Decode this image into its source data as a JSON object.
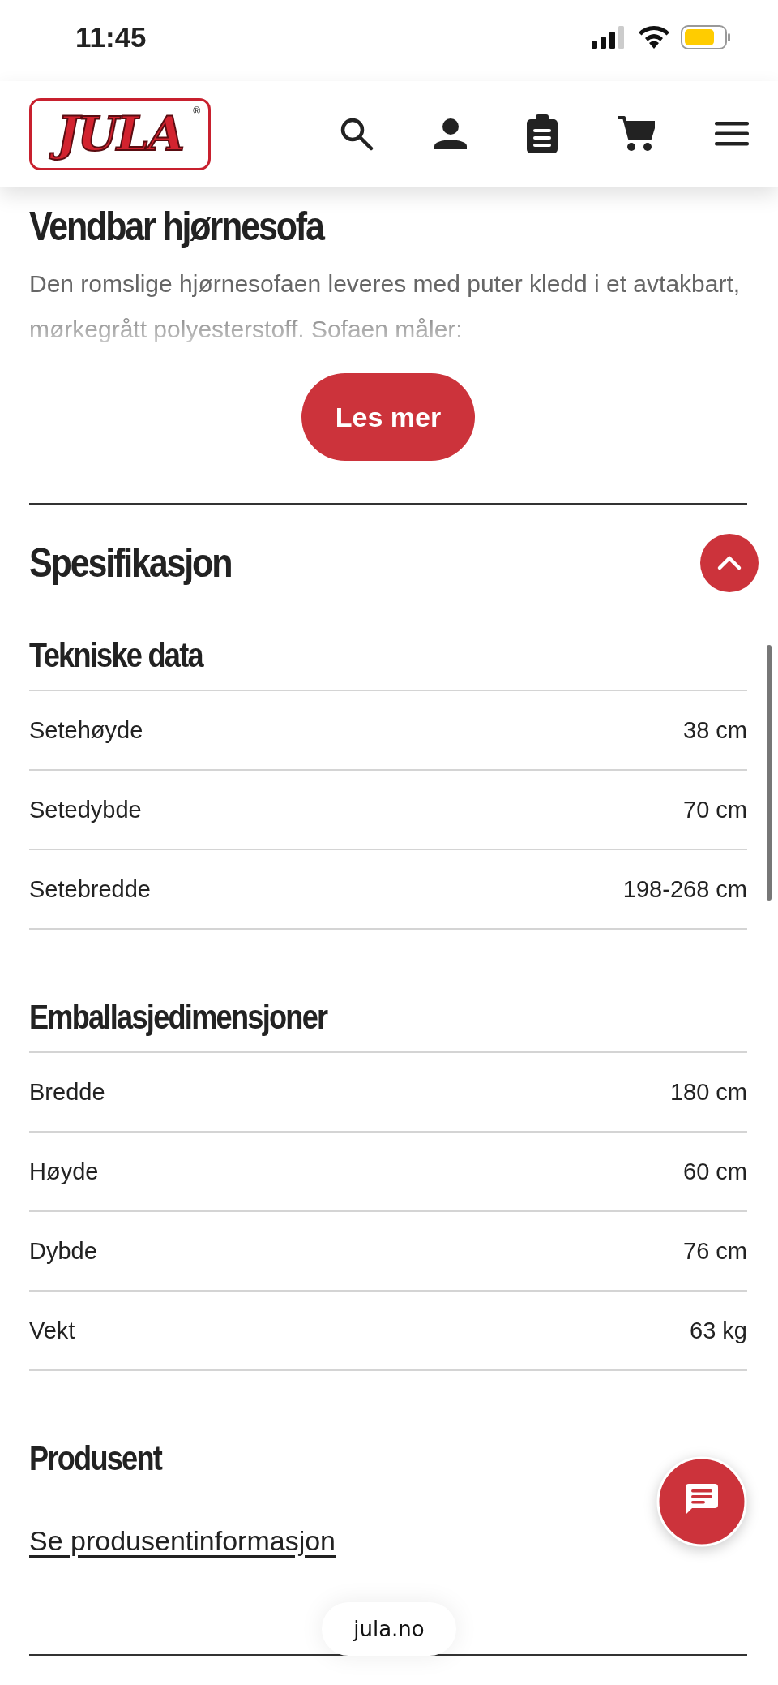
{
  "status_bar": {
    "time": "11:45"
  },
  "header": {
    "logo": {
      "text": "JULA",
      "mark": "®"
    },
    "icons": [
      {
        "kind": "search"
      },
      {
        "kind": "account"
      },
      {
        "kind": "list"
      },
      {
        "kind": "cart"
      },
      {
        "kind": "menu"
      }
    ]
  },
  "product": {
    "title": "Vendbar hjørnesofa",
    "description": "Den romslige hjørnesofaen leveres med puter kledd i et avtakbart, mørkegrått polyesterstoff. Sofaen måler:",
    "read_more": "Les mer"
  },
  "specification": {
    "title": "Spesifikasjon",
    "expanded": true,
    "groups": [
      {
        "title": "Tekniske data",
        "rows": [
          {
            "label": "Setehøyde",
            "value": "38 cm"
          },
          {
            "label": "Setedybde",
            "value": "70 cm"
          },
          {
            "label": "Setebredde",
            "value": "198-268 cm"
          }
        ]
      },
      {
        "title": "Emballasjedimensjoner",
        "rows": [
          {
            "label": "Bredde",
            "value": "180 cm"
          },
          {
            "label": "Høyde",
            "value": "60 cm"
          },
          {
            "label": "Dybde",
            "value": "76 cm"
          },
          {
            "label": "Vekt",
            "value": "63 kg"
          }
        ]
      },
      {
        "title": "Produsent",
        "link": "Se produsentinformasjon"
      }
    ]
  },
  "browser": {
    "url": "jula.no"
  }
}
